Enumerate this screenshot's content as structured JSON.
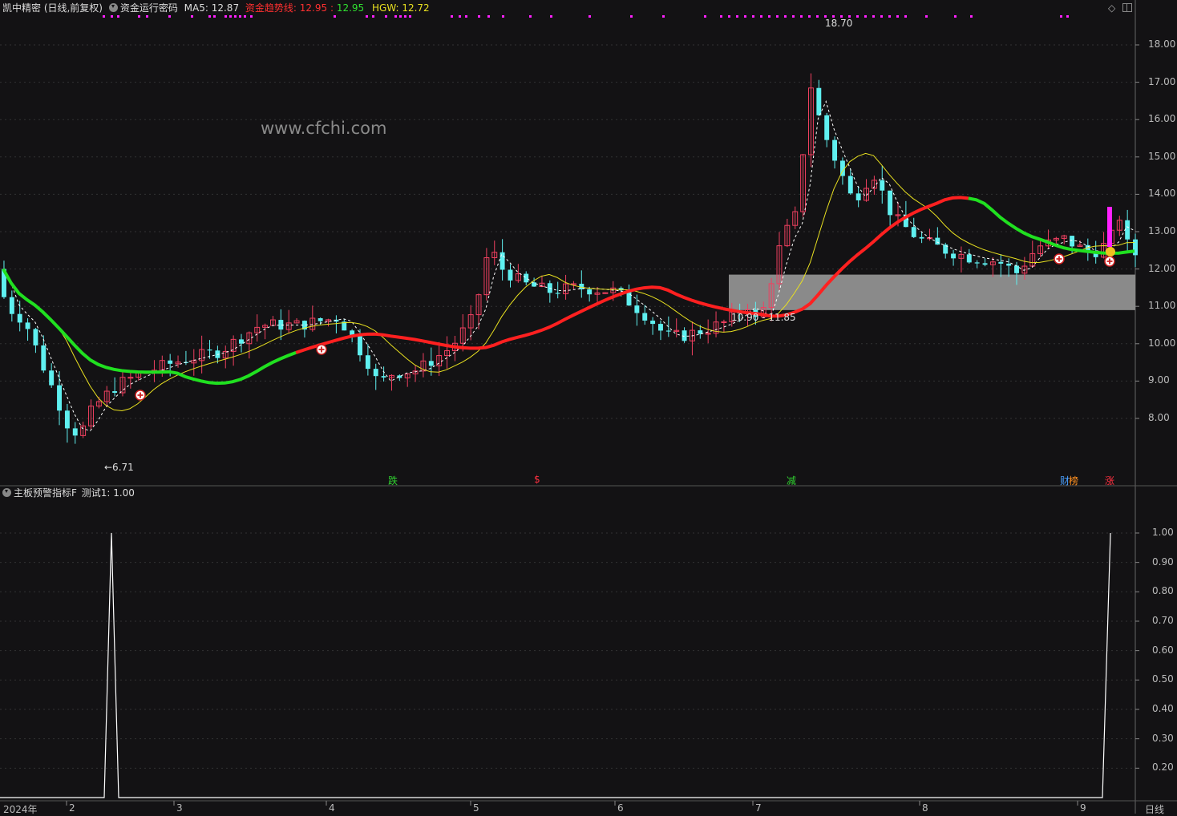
{
  "header": {
    "stock": "凯中精密 (日线,前复权)",
    "indicator": "资金运行密码",
    "ma5": "MA5: 12.87",
    "trend_label": "资金趋势线: 12.95",
    "trend_sep": " : ",
    "trend_val2": "12.95",
    "hgw": "HGW: 12.72"
  },
  "sub_header": {
    "indicator": "主板预警指标F",
    "test": "测试1: 1.00"
  },
  "watermark": "www.cfchi.com",
  "price_axis": [
    "18.00",
    "17.00",
    "16.00",
    "15.00",
    "14.00",
    "13.00",
    "12.00",
    "11.00",
    "10.00",
    "9.00",
    "8.00"
  ],
  "sub_axis": [
    "1.00",
    "0.90",
    "0.80",
    "0.70",
    "0.60",
    "0.50",
    "0.40",
    "0.30",
    "0.20"
  ],
  "time_axis": [
    "2024年",
    "2",
    "3",
    "4",
    "5",
    "6",
    "7",
    "8",
    "9"
  ],
  "period": "日线",
  "annotations": {
    "high": "18.70",
    "low": "←6.71",
    "zone": "10.90 - 11.85"
  },
  "signals": [
    "跌",
    "$",
    "减",
    "财",
    "榜",
    "涨"
  ],
  "icons": [
    "diamond-icon",
    "window-icon"
  ],
  "colors": {
    "up": "#f04060",
    "down": "#5ff0f0",
    "trend_up": "#ff2020",
    "trend_down": "#20e020",
    "ma": "#e8e020",
    "signal_pink": "#ff20ff"
  }
}
